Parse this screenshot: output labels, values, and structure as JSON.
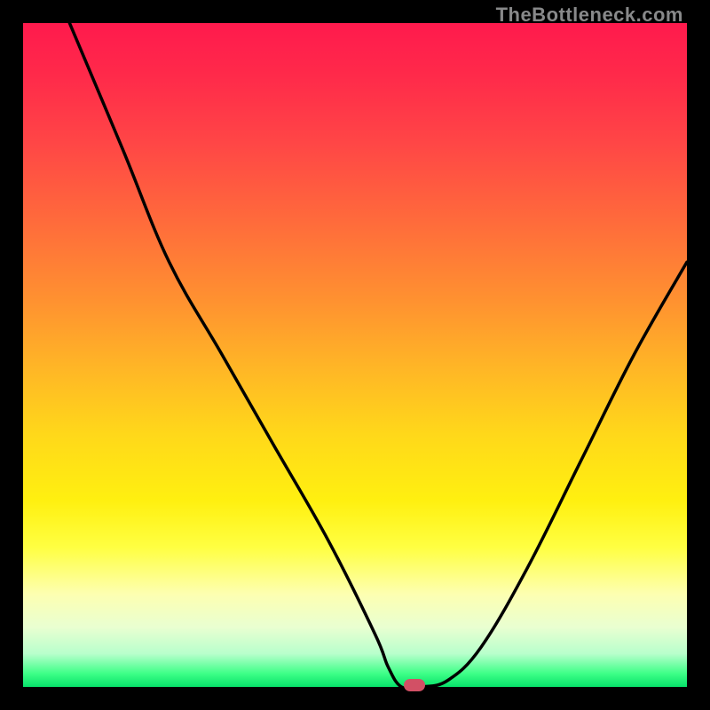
{
  "attribution": "TheBottleneck.com",
  "chart_data": {
    "type": "line",
    "title": "",
    "xlabel": "",
    "ylabel": "",
    "xlim": [
      0,
      100
    ],
    "ylim": [
      0,
      100
    ],
    "series": [
      {
        "name": "bottleneck-curve",
        "x": [
          7,
          15,
          22,
          30,
          38,
          46,
          53,
          55,
          57,
          60,
          64,
          69,
          76,
          84,
          92,
          100
        ],
        "values": [
          100,
          81,
          64,
          50,
          36,
          22,
          8,
          3,
          0,
          0,
          1,
          6,
          18,
          34,
          50,
          64
        ]
      }
    ],
    "marker": {
      "x": 59,
      "y": 0.3
    },
    "gradient_stops": [
      {
        "pct": 0,
        "color": "#ff1a4d"
      },
      {
        "pct": 50,
        "color": "#ffc31f"
      },
      {
        "pct": 80,
        "color": "#ffff42"
      },
      {
        "pct": 100,
        "color": "#07e26a"
      }
    ]
  }
}
